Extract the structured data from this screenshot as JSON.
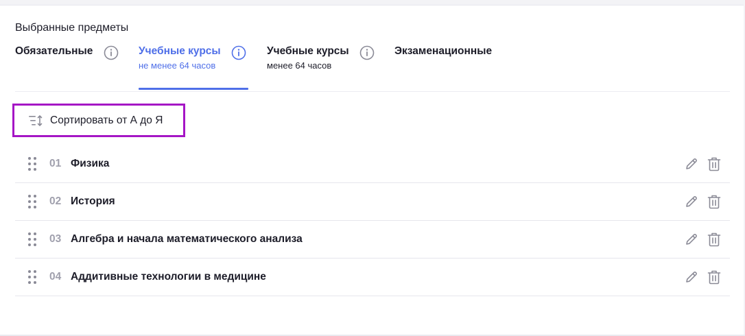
{
  "section": {
    "title": "Выбранные предметы"
  },
  "tabs": [
    {
      "label": "Обязательные",
      "sub": "",
      "active": false,
      "info_icon": "info-icon"
    },
    {
      "label": "Учебные курсы",
      "sub": "не менее 64 часов",
      "active": true,
      "info_icon": "info-icon"
    },
    {
      "label": "Учебные курсы",
      "sub": "менее 64 часов",
      "active": false,
      "info_icon": "info-icon"
    },
    {
      "label": "Экзаменационные",
      "sub": "",
      "active": false
    }
  ],
  "sort": {
    "label": "Сортировать от А до Я",
    "icon": "sort-icon"
  },
  "subjects": [
    {
      "number": "01",
      "name": "Физика"
    },
    {
      "number": "02",
      "name": "История"
    },
    {
      "number": "03",
      "name": "Алгебра и начала математического анализа"
    },
    {
      "number": "04",
      "name": "Аддитивные технологии в медицине"
    }
  ],
  "colors": {
    "accent": "#4f6fe8",
    "highlight_border": "#a515c5",
    "icon_gray": "#8a8a96",
    "text": "#1c1c28",
    "muted_number": "#a0a0ad"
  }
}
